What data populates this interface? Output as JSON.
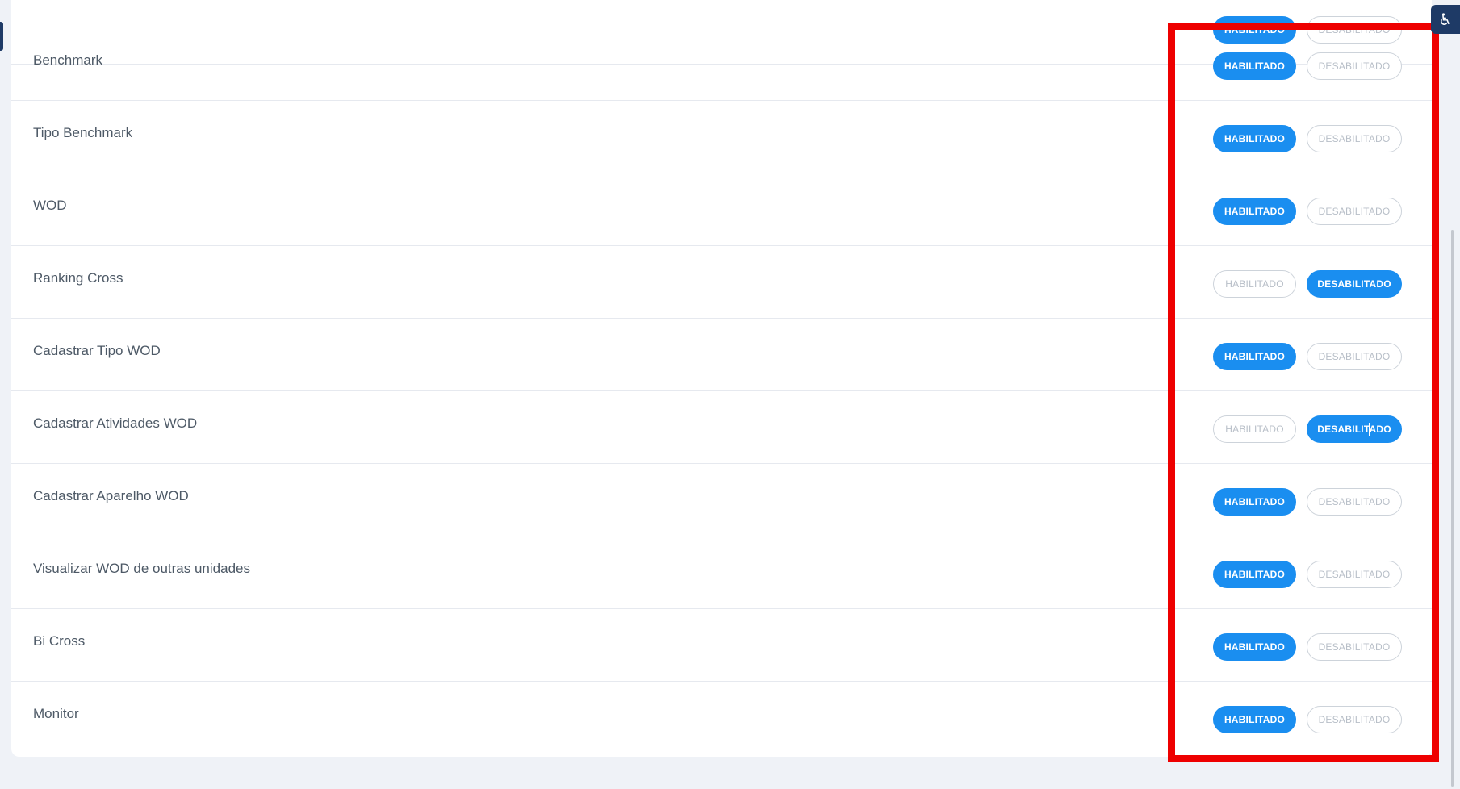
{
  "options": {
    "enabled_label": "HABILITADO",
    "disabled_label": "DESABILITADO"
  },
  "rows": [
    {
      "label": "",
      "state": "enabled"
    },
    {
      "label": "Benchmark",
      "state": "enabled"
    },
    {
      "label": "Tipo Benchmark",
      "state": "enabled"
    },
    {
      "label": "WOD",
      "state": "enabled"
    },
    {
      "label": "Ranking Cross",
      "state": "disabled"
    },
    {
      "label": "Cadastrar Tipo WOD",
      "state": "enabled"
    },
    {
      "label": "Cadastrar Atividades WOD",
      "state": "disabled"
    },
    {
      "label": "Cadastrar Aparelho WOD",
      "state": "enabled"
    },
    {
      "label": "Visualizar WOD de outras unidades",
      "state": "enabled"
    },
    {
      "label": "Bi Cross",
      "state": "enabled"
    },
    {
      "label": "Monitor",
      "state": "enabled"
    }
  ],
  "icons": {
    "corner_button": "accessibility-icon"
  },
  "colors": {
    "accent": "#1a8ef0",
    "highlight": "#ee0000",
    "navy": "#1e3a66"
  }
}
